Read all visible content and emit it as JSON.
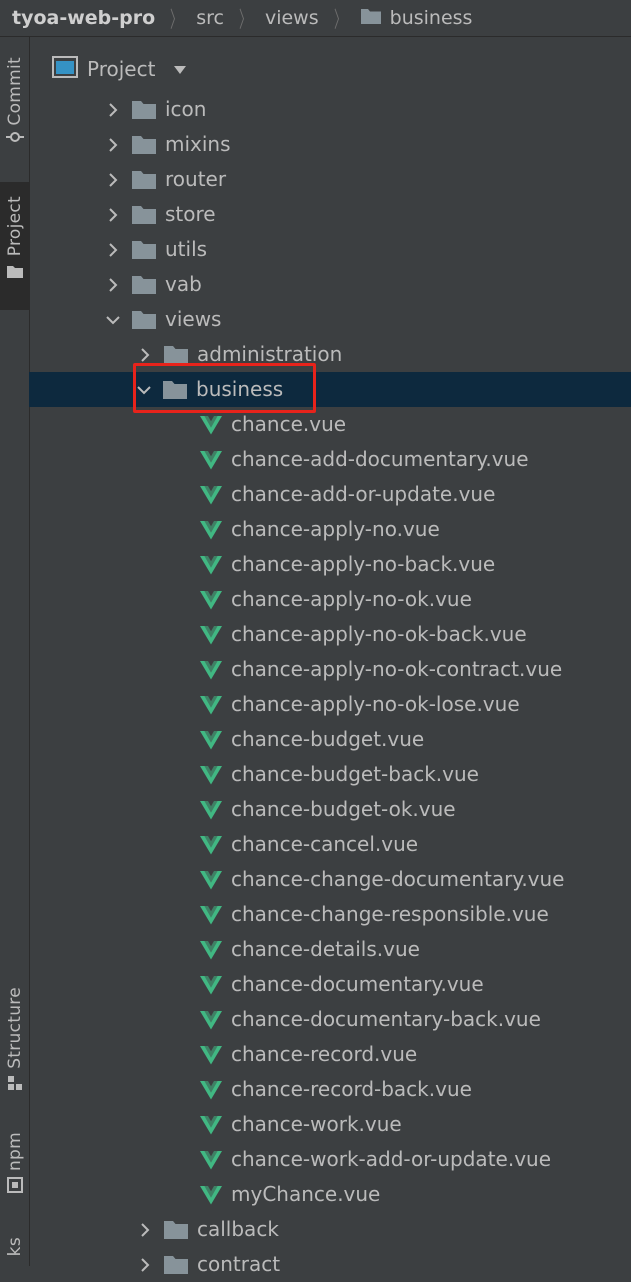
{
  "breadcrumb": {
    "project": "tyoa-web-pro",
    "items": [
      "src",
      "views",
      "business"
    ]
  },
  "side_tabs": {
    "commit": "Commit",
    "project": "Project",
    "structure": "Structure",
    "npm": "npm",
    "bookmarks_partial": "ks"
  },
  "panel": {
    "title": "Project",
    "icon": "project-window-icon",
    "dropdown_icon": "caret-down-icon"
  },
  "colors": {
    "background": "#3c3f41",
    "selection": "#0d293e",
    "folder": "#87939a",
    "vue": "#41b883",
    "highlight": "#e8231b"
  },
  "tree": {
    "folders_top": [
      {
        "label": "icon",
        "expanded": false
      },
      {
        "label": "mixins",
        "expanded": false
      },
      {
        "label": "router",
        "expanded": false
      },
      {
        "label": "store",
        "expanded": false
      },
      {
        "label": "utils",
        "expanded": false
      },
      {
        "label": "vab",
        "expanded": false
      },
      {
        "label": "views",
        "expanded": true
      }
    ],
    "views_children_before": [
      {
        "label": "administration",
        "expanded": false
      }
    ],
    "selected_folder": {
      "label": "business",
      "expanded": true
    },
    "business_files": [
      "chance.vue",
      "chance-add-documentary.vue",
      "chance-add-or-update.vue",
      "chance-apply-no.vue",
      "chance-apply-no-back.vue",
      "chance-apply-no-ok.vue",
      "chance-apply-no-ok-back.vue",
      "chance-apply-no-ok-contract.vue",
      "chance-apply-no-ok-lose.vue",
      "chance-budget.vue",
      "chance-budget-back.vue",
      "chance-budget-ok.vue",
      "chance-cancel.vue",
      "chance-change-documentary.vue",
      "chance-change-responsible.vue",
      "chance-details.vue",
      "chance-documentary.vue",
      "chance-documentary-back.vue",
      "chance-record.vue",
      "chance-record-back.vue",
      "chance-work.vue",
      "chance-work-add-or-update.vue",
      "myChance.vue"
    ],
    "views_children_after": [
      {
        "label": "callback",
        "expanded": false
      },
      {
        "label": "contract",
        "expanded": false
      }
    ]
  }
}
